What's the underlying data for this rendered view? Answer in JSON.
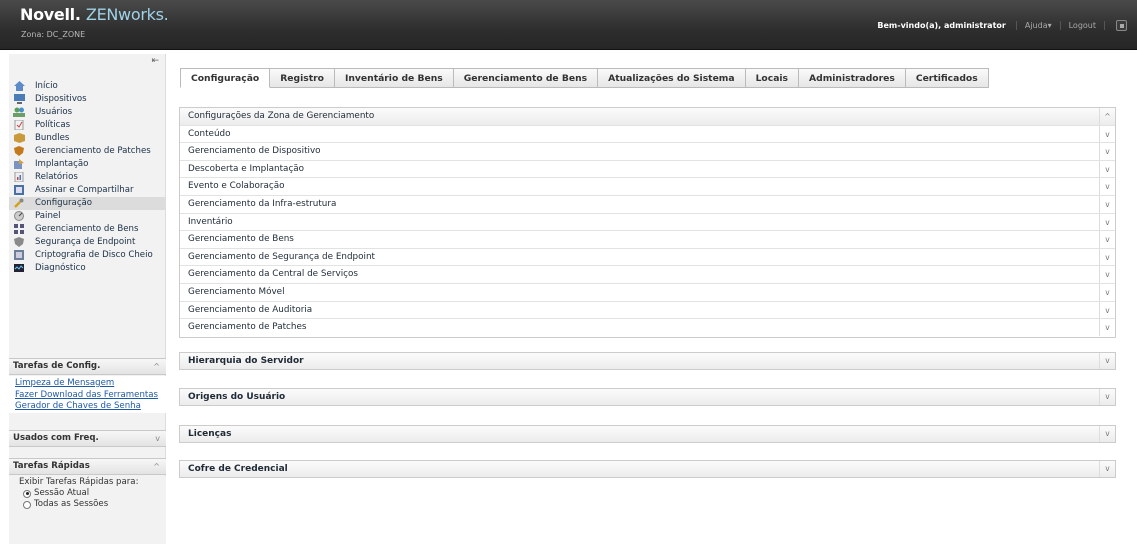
{
  "header": {
    "brand": "Novell.",
    "product": "ZENworks.",
    "zone": "Zona: DC_ZONE",
    "welcome": "Bem-vindo(a), administrator",
    "help": "Ajuda▾",
    "logout": "Logout"
  },
  "sidebar": {
    "collapse": "⇤",
    "nav": [
      {
        "label": "Início",
        "icon": "home-icon"
      },
      {
        "label": "Dispositivos",
        "icon": "devices-icon"
      },
      {
        "label": "Usuários",
        "icon": "users-icon"
      },
      {
        "label": "Políticas",
        "icon": "policies-icon"
      },
      {
        "label": "Bundles",
        "icon": "bundles-icon"
      },
      {
        "label": "Gerenciamento de Patches",
        "icon": "patch-icon"
      },
      {
        "label": "Implantação",
        "icon": "deployment-icon"
      },
      {
        "label": "Relatórios",
        "icon": "reports-icon"
      },
      {
        "label": "Assinar e Compartilhar",
        "icon": "subscribe-icon"
      },
      {
        "label": "Configuração",
        "icon": "configuration-icon"
      },
      {
        "label": "Painel",
        "icon": "dashboard-icon"
      },
      {
        "label": "Gerenciamento de Bens",
        "icon": "asset-icon"
      },
      {
        "label": "Segurança de Endpoint",
        "icon": "security-icon"
      },
      {
        "label": "Criptografia de Disco Cheio",
        "icon": "encryption-icon"
      },
      {
        "label": "Diagnóstico",
        "icon": "diagnostics-icon"
      }
    ],
    "config_tasks": {
      "title": "Tarefas de Config.",
      "links": [
        "Limpeza de Mensagem",
        "Fazer Download das Ferramentas",
        "Gerador de Chaves de Senha"
      ]
    },
    "frequent": {
      "title": "Usados com Freq."
    },
    "quick_tasks": {
      "title": "Tarefas Rápidas",
      "show_label": "Exibir Tarefas Rápidas para:",
      "options": [
        "Sessão Atual",
        "Todas as Sessões"
      ]
    }
  },
  "tabs": [
    "Configuração",
    "Registro",
    "Inventário de Bens",
    "Gerenciamento de Bens",
    "Atualizações do Sistema",
    "Locais",
    "Administradores",
    "Certificados"
  ],
  "zone_settings": [
    "Configurações da Zona de Gerenciamento",
    "Conteúdo",
    "Gerenciamento de Dispositivo",
    "Descoberta e Implantação",
    "Evento e Colaboração",
    "Gerenciamento da Infra-estrutura",
    "Inventário",
    "Gerenciamento de Bens",
    "Gerenciamento de Segurança de Endpoint",
    "Gerenciamento da Central de Serviços",
    "Gerenciamento Móvel",
    "Gerenciamento de Auditoria",
    "Gerenciamento de Patches"
  ],
  "panels": [
    "Hierarquia do Servidor",
    "Origens do Usuário",
    "Licenças",
    "Cofre de Credencial"
  ],
  "colors": {
    "header_bg": "#2e2e2e",
    "link": "#1f5aa6",
    "product": "#9fd3e8"
  }
}
